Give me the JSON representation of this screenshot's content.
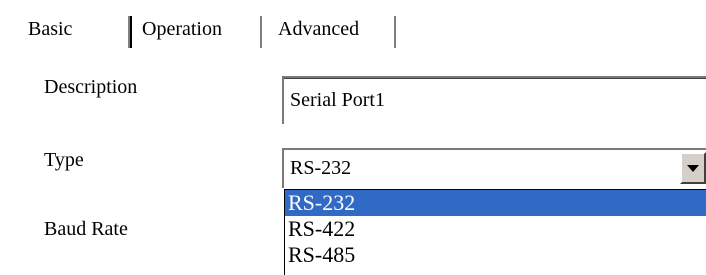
{
  "tabs": [
    {
      "label": "Basic",
      "active": true
    },
    {
      "label": "Operation",
      "active": false
    },
    {
      "label": "Advanced",
      "active": false
    }
  ],
  "form": {
    "description_label": "Description",
    "description_value": "Serial Port1",
    "type_label": "Type",
    "type_value": "RS-232",
    "baud_label": "Baud Rate"
  },
  "dropdown": {
    "options": [
      "RS-232",
      "RS-422",
      "RS-485"
    ],
    "selected_index": 0
  },
  "colors": {
    "selection": "#316ac5",
    "face": "#d4d0c8"
  },
  "icons": {
    "combo_arrow": "chevron-down-icon"
  }
}
